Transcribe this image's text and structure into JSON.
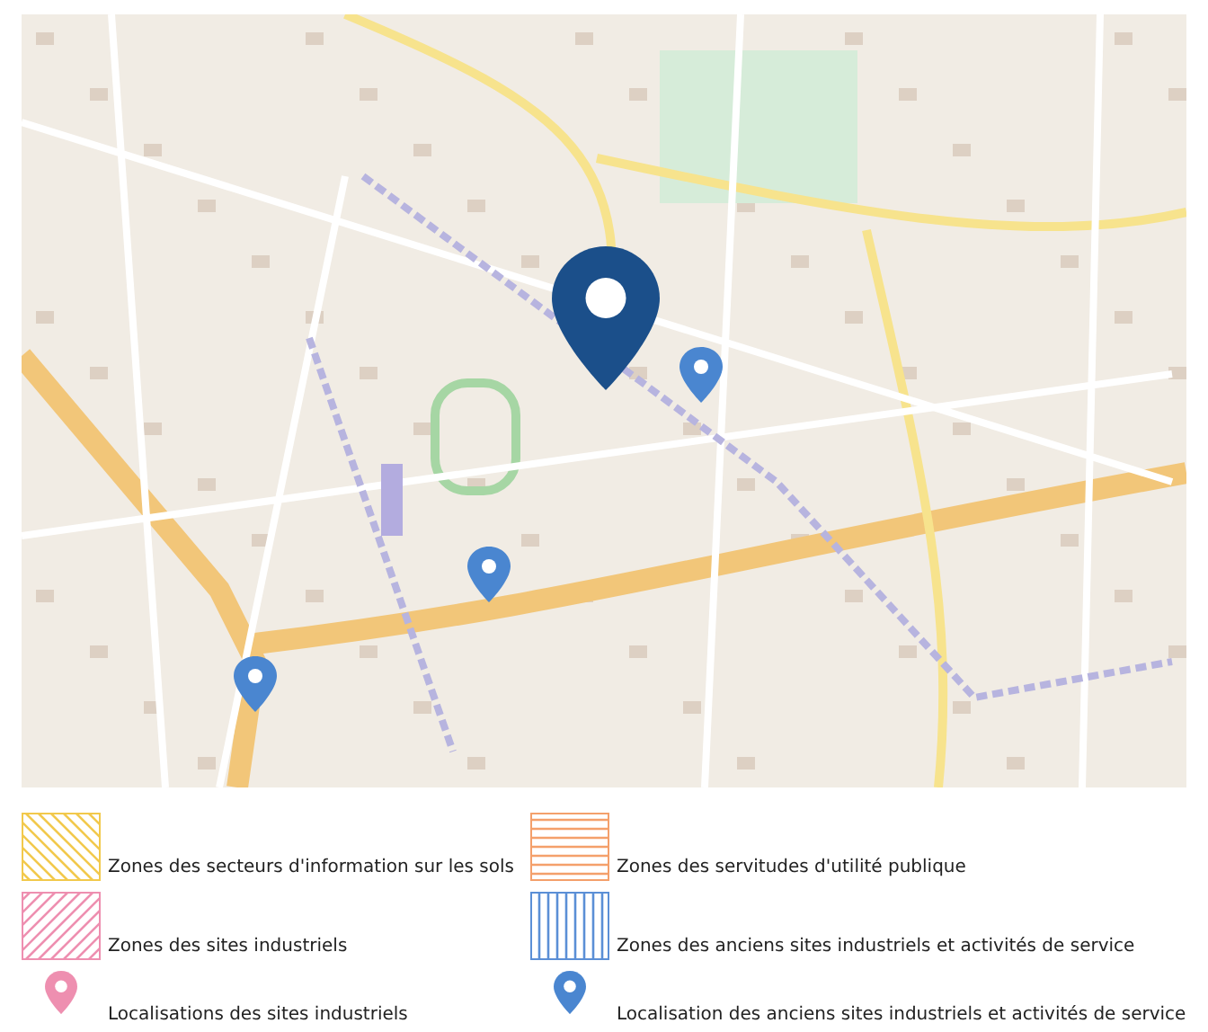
{
  "map": {
    "kind": "picture",
    "marker": {
      "color": "#1b4f8a"
    }
  },
  "legend": [
    {
      "kind": "hatch-diagonal",
      "color": "#f2c94c",
      "label": "Zones des secteurs d'information sur les sols"
    },
    {
      "kind": "hatch-horizontal",
      "color": "#f4a06b",
      "label": "Zones des servitudes d'utilité publique"
    },
    {
      "kind": "hatch-diagonal",
      "color": "#ee8fb0",
      "label": "Zones des sites industriels"
    },
    {
      "kind": "hatch-vertical",
      "color": "#5b8fd6",
      "label": "Zones des anciens sites industriels et activités de service"
    },
    {
      "kind": "pin",
      "color": "#ee8fb0",
      "label": "Localisations des sites industriels"
    },
    {
      "kind": "pin",
      "color": "#4a86d0",
      "label": "Localisation des anciens sites industriels et activités de service"
    }
  ]
}
